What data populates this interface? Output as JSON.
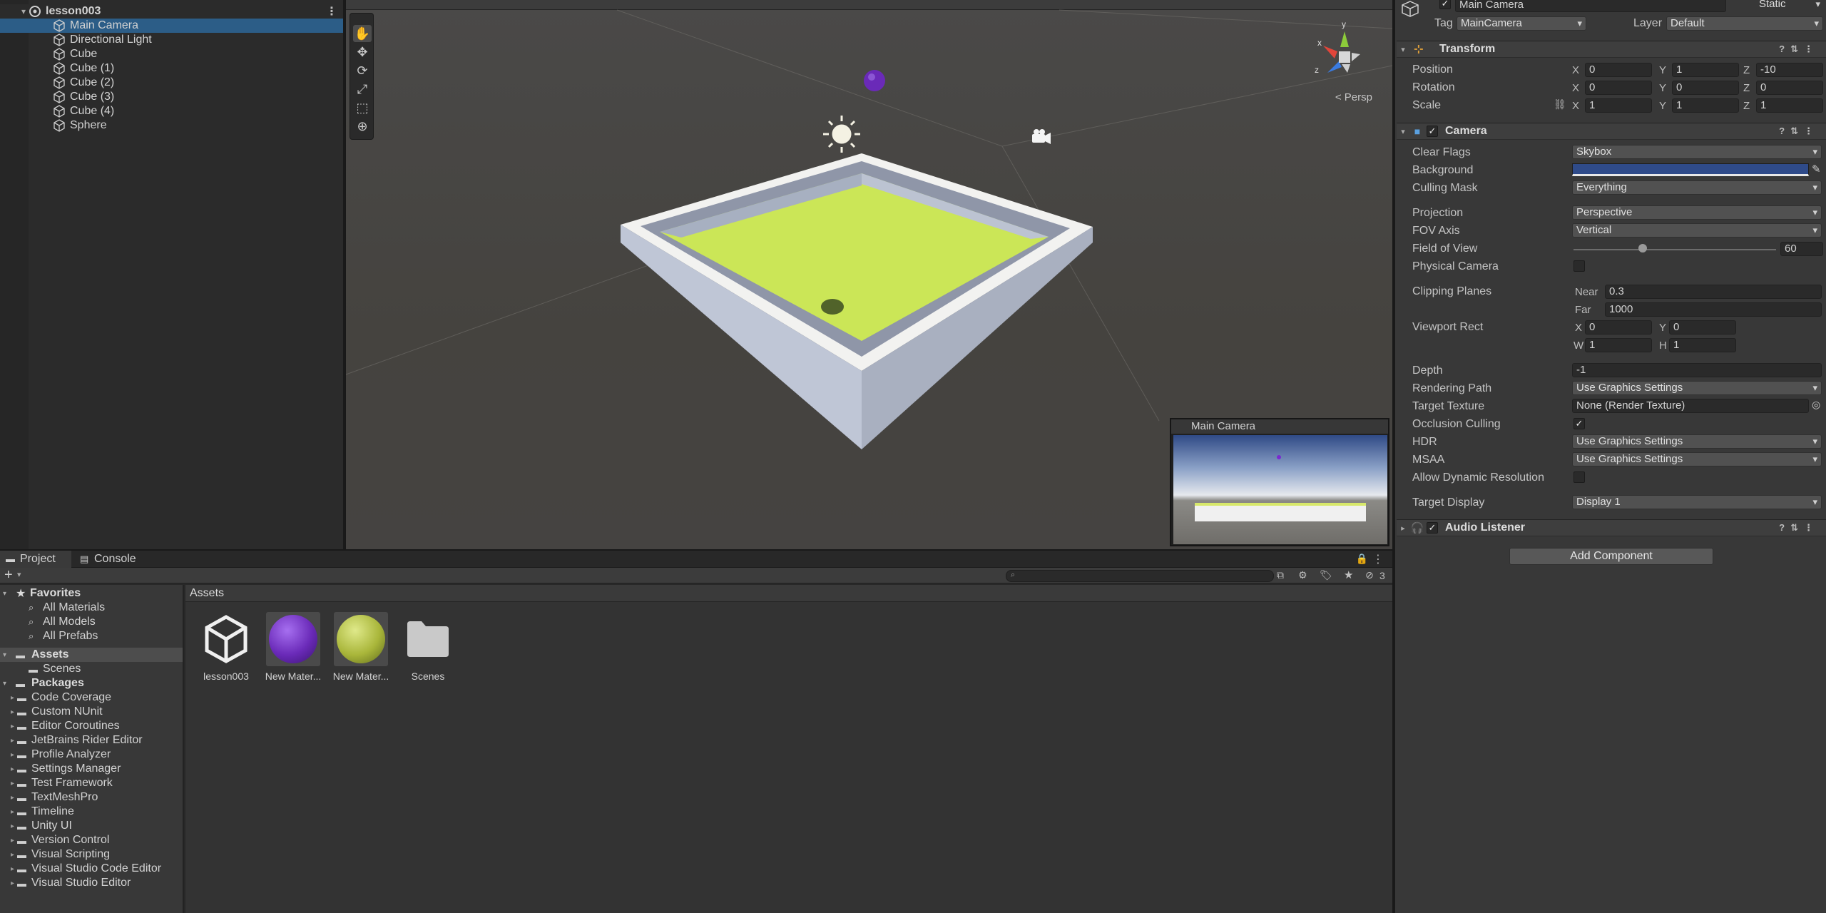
{
  "hierarchy": {
    "scene_name": "lesson003",
    "items": [
      "Main Camera",
      "Directional Light",
      "Cube",
      "Cube (1)",
      "Cube (2)",
      "Cube (3)",
      "Cube (4)",
      "Sphere"
    ],
    "selected_index": 0
  },
  "scene_view": {
    "persp_label": "< Persp",
    "camera_preview_title": "Main Camera",
    "gizmo_axes": {
      "y": "y",
      "x": "x",
      "z": "z"
    }
  },
  "inspector": {
    "object_name": "Main Camera",
    "static_label": "Static",
    "tag_label": "Tag",
    "tag_value": "MainCamera",
    "layer_label": "Layer",
    "layer_value": "Default",
    "transform": {
      "title": "Transform",
      "position_label": "Position",
      "rotation_label": "Rotation",
      "scale_label": "Scale",
      "position": {
        "x": "0",
        "y": "1",
        "z": "-10"
      },
      "rotation": {
        "x": "0",
        "y": "0",
        "z": "0"
      },
      "scale": {
        "x": "1",
        "y": "1",
        "z": "1"
      }
    },
    "camera": {
      "title": "Camera",
      "clear_flags_label": "Clear Flags",
      "clear_flags": "Skybox",
      "background_label": "Background",
      "background_color": "#2f4b8a",
      "culling_mask_label": "Culling Mask",
      "culling_mask": "Everything",
      "projection_label": "Projection",
      "projection": "Perspective",
      "fov_axis_label": "FOV Axis",
      "fov_axis": "Vertical",
      "fov_label": "Field of View",
      "fov": "60",
      "fov_slider_fraction": 0.34,
      "physical_camera_label": "Physical Camera",
      "clipping_label": "Clipping Planes",
      "near_label": "Near",
      "near": "0.3",
      "far_label": "Far",
      "far": "1000",
      "viewport_label": "Viewport Rect",
      "viewport": {
        "x": "0",
        "y": "0",
        "w": "1",
        "h": "1"
      },
      "depth_label": "Depth",
      "depth": "-1",
      "rendering_path_label": "Rendering Path",
      "rendering_path": "Use Graphics Settings",
      "target_texture_label": "Target Texture",
      "target_texture": "None (Render Texture)",
      "occlusion_label": "Occlusion Culling",
      "hdr_label": "HDR",
      "hdr": "Use Graphics Settings",
      "msaa_label": "MSAA",
      "msaa": "Use Graphics Settings",
      "dynres_label": "Allow Dynamic Resolution",
      "target_display_label": "Target Display",
      "target_display": "Display 1"
    },
    "audio_listener_title": "Audio Listener",
    "add_component_label": "Add Component"
  },
  "project": {
    "tabs": [
      "Project",
      "Console"
    ],
    "hidden_count": "3",
    "favorites_label": "Favorites",
    "favorites": [
      "All Materials",
      "All Models",
      "All Prefabs"
    ],
    "assets_label": "Assets",
    "assets_children": [
      "Scenes"
    ],
    "packages_label": "Packages",
    "packages": [
      "Code Coverage",
      "Custom NUnit",
      "Editor Coroutines",
      "JetBrains Rider Editor",
      "Profile Analyzer",
      "Settings Manager",
      "Test Framework",
      "TextMeshPro",
      "Timeline",
      "Unity UI",
      "Version Control",
      "Visual Scripting",
      "Visual Studio Code Editor",
      "Visual Studio Editor"
    ],
    "assets_header": "Assets",
    "asset_items": [
      "lesson003",
      "New Mater...",
      "New Mater...",
      "Scenes"
    ]
  }
}
